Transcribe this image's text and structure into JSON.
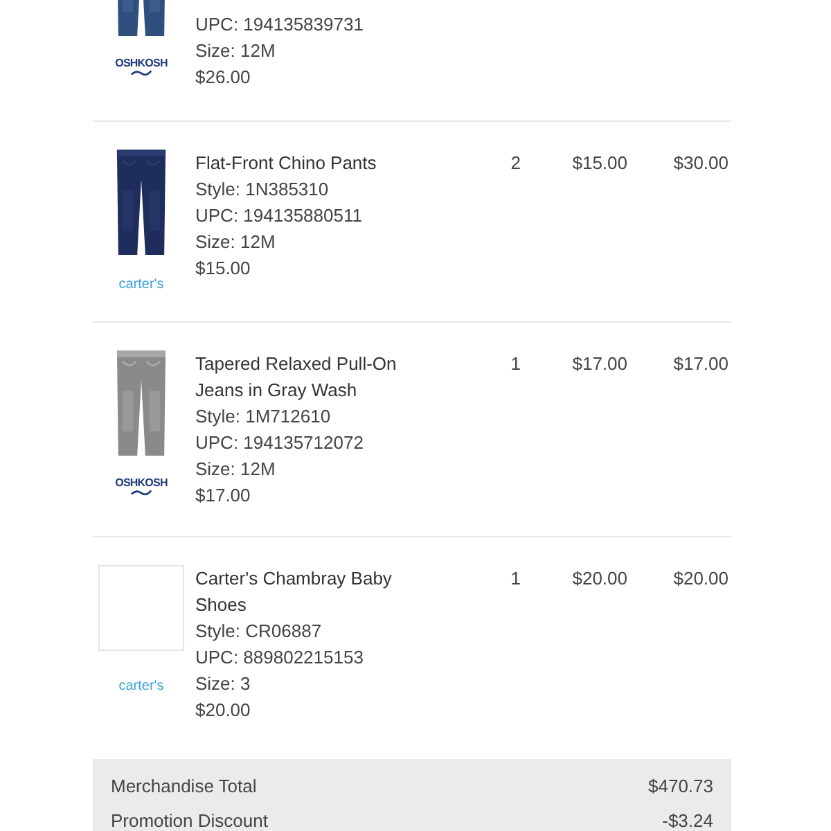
{
  "items": [
    {
      "image": {
        "kind": "picture"
      },
      "brand": {
        "kind": "oshkosh",
        "text": "OSHKOSH"
      },
      "clipped": true,
      "details": [
        "UPC: 194135839731",
        "Size: 12M",
        "$26.00"
      ]
    },
    {
      "image": {
        "kind": "picture"
      },
      "brand": {
        "kind": "carters",
        "text": "carter's"
      },
      "clipped": false,
      "name": "Flat-Front Chino Pants",
      "details": [
        "Style: 1N385310",
        "UPC: 194135880511",
        "Size: 12M",
        "$15.00"
      ],
      "qty": "2",
      "price": "$15.00",
      "total": "$30.00"
    },
    {
      "image": {
        "kind": "picture"
      },
      "brand": {
        "kind": "oshkosh",
        "text": "OSHKOSH"
      },
      "clipped": false,
      "name": "Tapered Relaxed Pull-On Jeans in Gray Wash",
      "details": [
        "Style: 1M712610",
        "UPC: 194135712072",
        "Size: 12M",
        "$17.00"
      ],
      "qty": "1",
      "price": "$17.00",
      "total": "$17.00"
    },
    {
      "image": {
        "kind": "placeholder"
      },
      "brand": {
        "kind": "carters",
        "text": "carter's"
      },
      "clipped": false,
      "name": "Carter's Chambray Baby Shoes",
      "details": [
        "Style: CR06887",
        "UPC: 889802215153",
        "Size: 3",
        "$20.00"
      ],
      "qty": "1",
      "price": "$20.00",
      "total": "$20.00"
    }
  ],
  "summary": [
    {
      "label": "Merchandise Total",
      "value": "$470.73"
    },
    {
      "label": "Promotion Discount",
      "value": "-$3.24"
    }
  ]
}
